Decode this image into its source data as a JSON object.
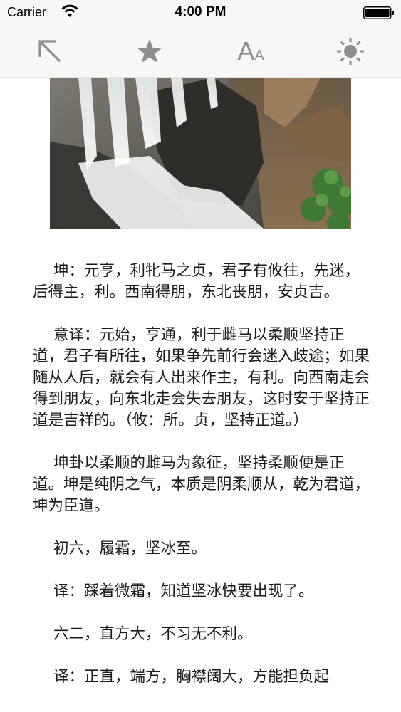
{
  "status_bar": {
    "carrier": "Carrier",
    "time": "4:00 PM"
  },
  "toolbar": {
    "back_icon": "arrow-up-left-icon",
    "favorite_icon": "star-icon",
    "font_size_icon": "font-size-icon",
    "font_big": "A",
    "font_small": "A",
    "brightness_icon": "sun-icon",
    "icon_color": "#8e8e8e"
  },
  "header_image": {
    "subject": "waterfall-photo"
  },
  "article": {
    "paragraphs": [
      "坤：元亨，利牝马之贞，君子有攸往，先迷，后得主，利。西南得朋，东北丧朋，安贞吉。",
      "意译：元始，亨通，利于雌马以柔顺坚持正道，君子有所往，如果争先前行会迷入歧途；如果随从人后，就会有人出来作主，有利。向西南走会得到朋友，向东北走会失去朋友，这时安于坚持正道是吉祥的。（攸：所。贞，坚持正道。）",
      "坤卦以柔顺的雌马为象征，坚持柔顺便是正道。坤是纯阴之气，本质是阴柔顺从，乾为君道，坤为臣道。",
      "初六，履霜，坚冰至。",
      "译：踩着微霜，知道坚冰快要出现了。",
      "六二，直方大，不习无不利。",
      "译：正直，端方，胸襟阔大，方能担负起"
    ]
  }
}
